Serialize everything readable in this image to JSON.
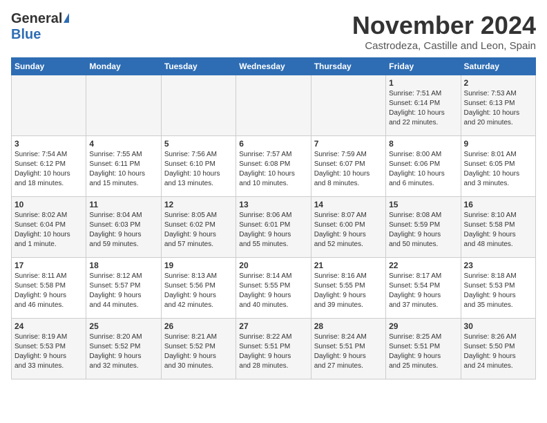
{
  "header": {
    "logo_general": "General",
    "logo_blue": "Blue",
    "month_year": "November 2024",
    "location": "Castrodeza, Castille and Leon, Spain"
  },
  "calendar": {
    "days_of_week": [
      "Sunday",
      "Monday",
      "Tuesday",
      "Wednesday",
      "Thursday",
      "Friday",
      "Saturday"
    ],
    "weeks": [
      [
        {
          "day": "",
          "info": ""
        },
        {
          "day": "",
          "info": ""
        },
        {
          "day": "",
          "info": ""
        },
        {
          "day": "",
          "info": ""
        },
        {
          "day": "",
          "info": ""
        },
        {
          "day": "1",
          "info": "Sunrise: 7:51 AM\nSunset: 6:14 PM\nDaylight: 10 hours\nand 22 minutes."
        },
        {
          "day": "2",
          "info": "Sunrise: 7:53 AM\nSunset: 6:13 PM\nDaylight: 10 hours\nand 20 minutes."
        }
      ],
      [
        {
          "day": "3",
          "info": "Sunrise: 7:54 AM\nSunset: 6:12 PM\nDaylight: 10 hours\nand 18 minutes."
        },
        {
          "day": "4",
          "info": "Sunrise: 7:55 AM\nSunset: 6:11 PM\nDaylight: 10 hours\nand 15 minutes."
        },
        {
          "day": "5",
          "info": "Sunrise: 7:56 AM\nSunset: 6:10 PM\nDaylight: 10 hours\nand 13 minutes."
        },
        {
          "day": "6",
          "info": "Sunrise: 7:57 AM\nSunset: 6:08 PM\nDaylight: 10 hours\nand 10 minutes."
        },
        {
          "day": "7",
          "info": "Sunrise: 7:59 AM\nSunset: 6:07 PM\nDaylight: 10 hours\nand 8 minutes."
        },
        {
          "day": "8",
          "info": "Sunrise: 8:00 AM\nSunset: 6:06 PM\nDaylight: 10 hours\nand 6 minutes."
        },
        {
          "day": "9",
          "info": "Sunrise: 8:01 AM\nSunset: 6:05 PM\nDaylight: 10 hours\nand 3 minutes."
        }
      ],
      [
        {
          "day": "10",
          "info": "Sunrise: 8:02 AM\nSunset: 6:04 PM\nDaylight: 10 hours\nand 1 minute."
        },
        {
          "day": "11",
          "info": "Sunrise: 8:04 AM\nSunset: 6:03 PM\nDaylight: 9 hours\nand 59 minutes."
        },
        {
          "day": "12",
          "info": "Sunrise: 8:05 AM\nSunset: 6:02 PM\nDaylight: 9 hours\nand 57 minutes."
        },
        {
          "day": "13",
          "info": "Sunrise: 8:06 AM\nSunset: 6:01 PM\nDaylight: 9 hours\nand 55 minutes."
        },
        {
          "day": "14",
          "info": "Sunrise: 8:07 AM\nSunset: 6:00 PM\nDaylight: 9 hours\nand 52 minutes."
        },
        {
          "day": "15",
          "info": "Sunrise: 8:08 AM\nSunset: 5:59 PM\nDaylight: 9 hours\nand 50 minutes."
        },
        {
          "day": "16",
          "info": "Sunrise: 8:10 AM\nSunset: 5:58 PM\nDaylight: 9 hours\nand 48 minutes."
        }
      ],
      [
        {
          "day": "17",
          "info": "Sunrise: 8:11 AM\nSunset: 5:58 PM\nDaylight: 9 hours\nand 46 minutes."
        },
        {
          "day": "18",
          "info": "Sunrise: 8:12 AM\nSunset: 5:57 PM\nDaylight: 9 hours\nand 44 minutes."
        },
        {
          "day": "19",
          "info": "Sunrise: 8:13 AM\nSunset: 5:56 PM\nDaylight: 9 hours\nand 42 minutes."
        },
        {
          "day": "20",
          "info": "Sunrise: 8:14 AM\nSunset: 5:55 PM\nDaylight: 9 hours\nand 40 minutes."
        },
        {
          "day": "21",
          "info": "Sunrise: 8:16 AM\nSunset: 5:55 PM\nDaylight: 9 hours\nand 39 minutes."
        },
        {
          "day": "22",
          "info": "Sunrise: 8:17 AM\nSunset: 5:54 PM\nDaylight: 9 hours\nand 37 minutes."
        },
        {
          "day": "23",
          "info": "Sunrise: 8:18 AM\nSunset: 5:53 PM\nDaylight: 9 hours\nand 35 minutes."
        }
      ],
      [
        {
          "day": "24",
          "info": "Sunrise: 8:19 AM\nSunset: 5:53 PM\nDaylight: 9 hours\nand 33 minutes."
        },
        {
          "day": "25",
          "info": "Sunrise: 8:20 AM\nSunset: 5:52 PM\nDaylight: 9 hours\nand 32 minutes."
        },
        {
          "day": "26",
          "info": "Sunrise: 8:21 AM\nSunset: 5:52 PM\nDaylight: 9 hours\nand 30 minutes."
        },
        {
          "day": "27",
          "info": "Sunrise: 8:22 AM\nSunset: 5:51 PM\nDaylight: 9 hours\nand 28 minutes."
        },
        {
          "day": "28",
          "info": "Sunrise: 8:24 AM\nSunset: 5:51 PM\nDaylight: 9 hours\nand 27 minutes."
        },
        {
          "day": "29",
          "info": "Sunrise: 8:25 AM\nSunset: 5:51 PM\nDaylight: 9 hours\nand 25 minutes."
        },
        {
          "day": "30",
          "info": "Sunrise: 8:26 AM\nSunset: 5:50 PM\nDaylight: 9 hours\nand 24 minutes."
        }
      ]
    ]
  }
}
